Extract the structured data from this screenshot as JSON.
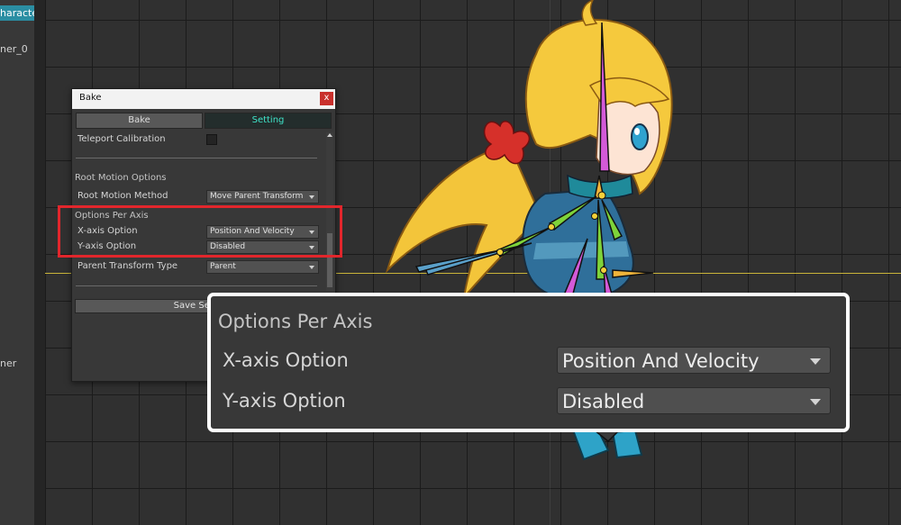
{
  "hierarchy": {
    "items": [
      "haracter_",
      "ner_0",
      "ner"
    ]
  },
  "bake_window": {
    "title": "Bake",
    "close_label": "x",
    "tabs": [
      "Bake",
      "Setting"
    ],
    "active_tab": "Setting",
    "teleport_calibration": {
      "label": "Teleport Calibration",
      "checked": false
    },
    "root_motion_options_header": "Root Motion Options",
    "root_motion_method": {
      "label": "Root Motion Method",
      "value": "Move Parent Transform"
    },
    "options_per_axis_header": "Options Per Axis",
    "x_axis_option": {
      "label": "X-axis Option",
      "value": "Position And Velocity"
    },
    "y_axis_option": {
      "label": "Y-axis Option",
      "value": "Disabled"
    },
    "parent_transform_type": {
      "label": "Parent Transform Type",
      "value": "Parent"
    },
    "save_settings_label": "Save Settings"
  },
  "zoom_callout": {
    "header": "Options Per Axis",
    "x_axis_label": "X-axis Option",
    "x_axis_value": "Position And Velocity",
    "y_axis_label": "Y-axis Option",
    "y_axis_value": "Disabled"
  },
  "colors": {
    "highlight": "#e2262c",
    "active_tab_text": "#3fe3c8",
    "hierarchy_selected": "#2b8ea3",
    "ground_line": "#c9b43a"
  }
}
